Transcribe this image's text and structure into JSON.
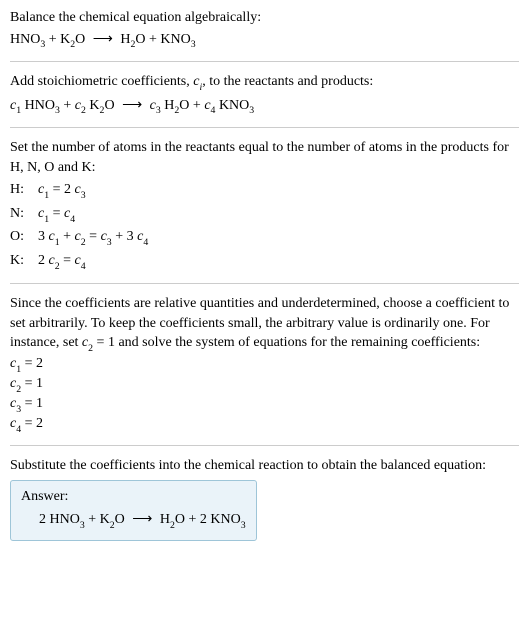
{
  "problem": {
    "title": "Balance the chemical equation algebraically:",
    "lhs1": "HNO",
    "lhs1_sub": "3",
    "plus1": " + K",
    "lhs2_sub": "2",
    "lhs2_rest": "O",
    "arrow": "⟶",
    "rhs1": "H",
    "rhs1_sub": "2",
    "rhs1_rest": "O + KNO",
    "rhs2_sub": "3"
  },
  "step1": {
    "text_a": "Add stoichiometric coefficients, ",
    "ci": "c",
    "ci_sub": "i",
    "text_b": ", to the reactants and products:",
    "c1": "c",
    "c1s": "1",
    "r1": " HNO",
    "r1s": "3",
    "plus1": " + ",
    "c2": "c",
    "c2s": "2",
    "r2": " K",
    "r2s": "2",
    "r2b": "O",
    "arrow": "⟶",
    "c3": "c",
    "c3s": "3",
    "r3": " H",
    "r3s": "2",
    "r3b": "O + ",
    "c4": "c",
    "c4s": "4",
    "r4": " KNO",
    "r4s": "3"
  },
  "step2": {
    "text": "Set the number of atoms in the reactants equal to the number of atoms in the products for H, N, O and K:",
    "rows": [
      {
        "el": "H:",
        "lhs_c": "c",
        "lhs_s": "1",
        "mid": " = 2 ",
        "rhs_c": "c",
        "rhs_s": "3",
        "tail": ""
      },
      {
        "el": "N:",
        "lhs_c": "c",
        "lhs_s": "1",
        "mid": " = ",
        "rhs_c": "c",
        "rhs_s": "4",
        "tail": ""
      },
      {
        "el": "O:",
        "pre": "3 ",
        "lhs_c": "c",
        "lhs_s": "1",
        "mid": " + ",
        "m_c": "c",
        "m_s": "2",
        "mid2": " = ",
        "rhs_c": "c",
        "rhs_s": "3",
        "mid3": " + 3 ",
        "r2_c": "c",
        "r2_s": "4"
      },
      {
        "el": "K:",
        "pre": "2 ",
        "lhs_c": "c",
        "lhs_s": "2",
        "mid": " = ",
        "rhs_c": "c",
        "rhs_s": "4",
        "tail": ""
      }
    ]
  },
  "step3": {
    "text_a": "Since the coefficients are relative quantities and underdetermined, choose a coefficient to set arbitrarily. To keep the coefficients small, the arbitrary value is ordinarily one. For instance, set ",
    "cset": "c",
    "cset_sub": "2",
    "text_b": " = 1 and solve the system of equations for the remaining coefficients:",
    "coefs": [
      {
        "c": "c",
        "s": "1",
        "v": " = 2"
      },
      {
        "c": "c",
        "s": "2",
        "v": " = 1"
      },
      {
        "c": "c",
        "s": "3",
        "v": " = 1"
      },
      {
        "c": "c",
        "s": "4",
        "v": " = 2"
      }
    ]
  },
  "step4": {
    "text": "Substitute the coefficients into the chemical reaction to obtain the balanced equation:"
  },
  "answer": {
    "label": "Answer:",
    "p1": "2 HNO",
    "s1": "3",
    "p2": " + K",
    "s2": "2",
    "p2b": "O",
    "arrow": "⟶",
    "p3": "H",
    "s3": "2",
    "p3b": "O + 2 KNO",
    "s4": "3"
  }
}
